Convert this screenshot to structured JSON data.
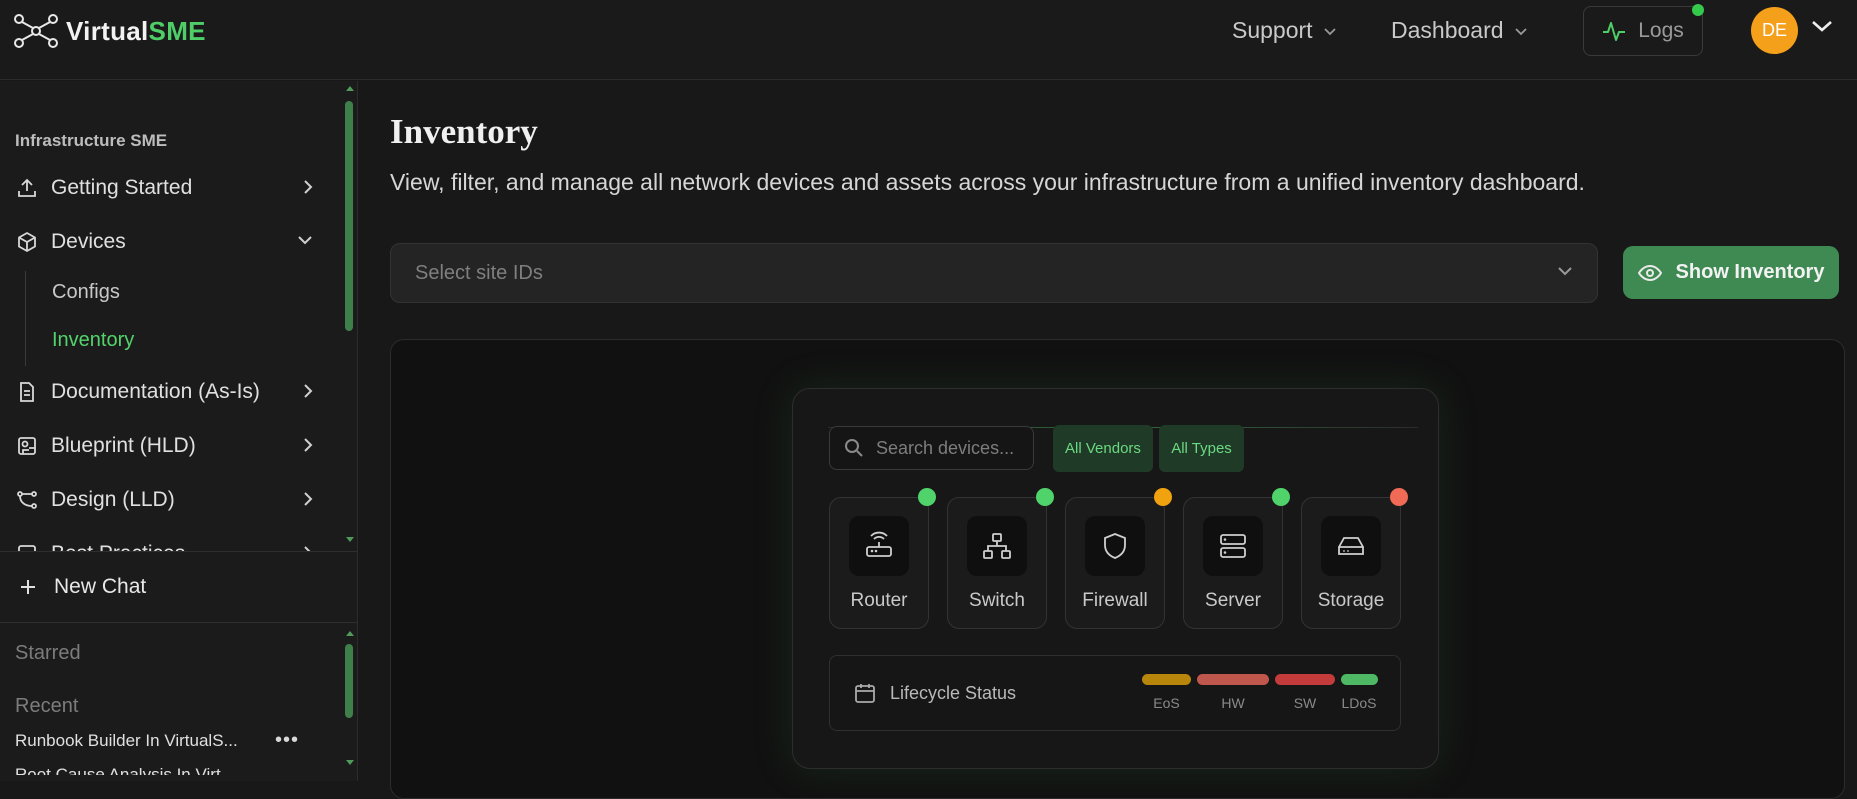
{
  "app": {
    "logo_prefix": "Virtual",
    "logo_suffix": "SME",
    "accent_color": "#4fce68",
    "avatar_color": "#f4a01b"
  },
  "topnav": {
    "support_label": "Support",
    "dashboard_label": "Dashboard",
    "logs_label": "Logs",
    "avatar_initials": "DE"
  },
  "sidebar": {
    "section_label": "Infrastructure SME",
    "items": [
      {
        "label": "Getting Started",
        "icon": "upload-icon"
      },
      {
        "label": "Devices",
        "icon": "cube-icon"
      },
      {
        "label": "Documentation (As-Is)",
        "icon": "document-icon"
      },
      {
        "label": "Blueprint (HLD)",
        "icon": "blueprint-icon"
      },
      {
        "label": "Design (LLD)",
        "icon": "bezier-icon"
      },
      {
        "label": "Best Practices",
        "icon": "checklist-icon"
      }
    ],
    "devices_sub": [
      "Configs",
      "Inventory"
    ],
    "new_chat_label": "New Chat",
    "starred_label": "Starred",
    "recent_label": "Recent",
    "recent_items": [
      "Runbook Builder In VirtualS...",
      "Root Cause Analysis In Virt..."
    ]
  },
  "main": {
    "title": "Inventory",
    "description": "View, filter, and manage all network devices and assets across your infrastructure from a unified inventory dashboard.",
    "site_select_placeholder": "Select site IDs",
    "show_inventory_label": "Show Inventory"
  },
  "preview": {
    "search_placeholder": "Search devices...",
    "chips": [
      "All Vendors",
      "All Types"
    ],
    "devices": [
      {
        "label": "Router",
        "icon": "router-icon",
        "status_color": "#4fd36a"
      },
      {
        "label": "Switch",
        "icon": "switch-icon",
        "status_color": "#4fd36a"
      },
      {
        "label": "Firewall",
        "icon": "shield-icon",
        "status_color": "#f0a30e"
      },
      {
        "label": "Server",
        "icon": "server-icon",
        "status_color": "#4fd36a"
      },
      {
        "label": "Storage",
        "icon": "storage-icon",
        "status_color": "#f06a55"
      }
    ],
    "lifecycle_label": "Lifecycle Status",
    "lifecycle": [
      {
        "label": "EoS",
        "color": "#b8860b"
      },
      {
        "label": "HW",
        "color": "#c0574d"
      },
      {
        "label": "SW",
        "color": "#c43b3b"
      },
      {
        "label": "LDoS",
        "color": "#4fb865"
      }
    ]
  }
}
